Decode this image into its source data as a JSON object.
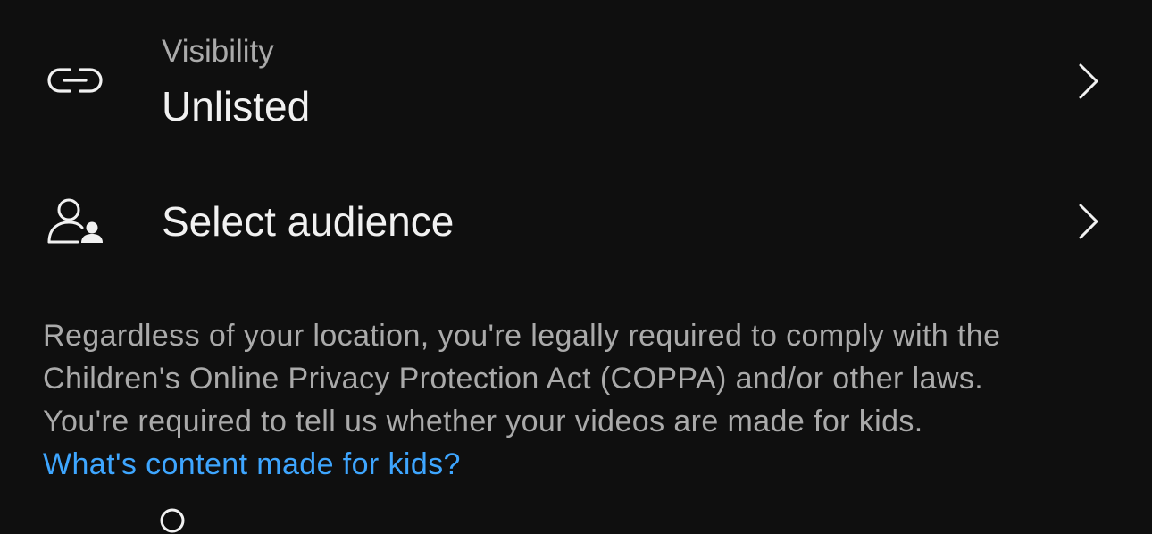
{
  "visibility": {
    "label": "Visibility",
    "value": "Unlisted",
    "icon": "link-icon"
  },
  "audience": {
    "title": "Select audience",
    "icon": "person-audience-icon"
  },
  "info": {
    "line1": "Regardless of your location, you're legally required to comply with the",
    "line2": "Children's Online Privacy Protection Act (COPPA) and/or other laws.",
    "line3": "You're required to tell us whether your videos are made for kids.",
    "link_text": "What's content made for kids?"
  },
  "colors": {
    "background": "#0f0f0f",
    "primary_text": "#f1f1f1",
    "secondary_text": "#aaaaaa",
    "link": "#3ea6ff"
  }
}
